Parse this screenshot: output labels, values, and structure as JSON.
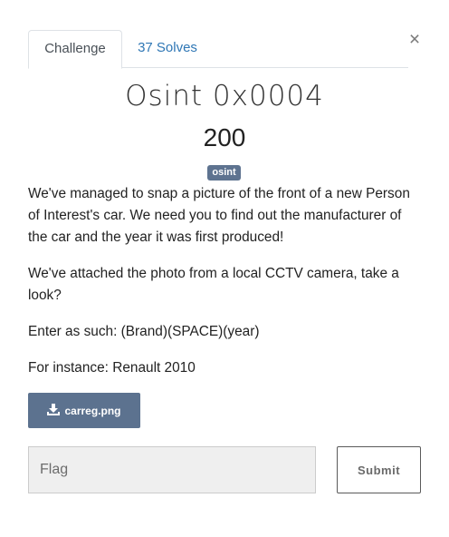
{
  "modal": {
    "close_label": "×",
    "tabs": [
      {
        "label": "Challenge",
        "active": true
      },
      {
        "label": "37 Solves",
        "active": false
      }
    ],
    "challenge": {
      "name": "Osint 0x0004",
      "value": "200",
      "tag": "osint",
      "description": [
        "We've managed to snap a picture of the front of a new Person of Interest's car. We need you to find out the manufacturer of the car and the year it was first produced!",
        "We've attached the photo from a local CCTV camera, take a look?",
        "Enter as such: (Brand)(SPACE)(year)",
        "For instance: Renault 2010"
      ],
      "file": {
        "name": "carreg.png",
        "icon": "download-icon"
      }
    },
    "flag_input": {
      "value": "",
      "placeholder": "Flag"
    },
    "submit_label": "Submit"
  },
  "colors": {
    "tag_bg": "#5e7390",
    "file_button_bg": "#5c728f",
    "link": "#2f77b5",
    "input_bg": "#efefef"
  }
}
